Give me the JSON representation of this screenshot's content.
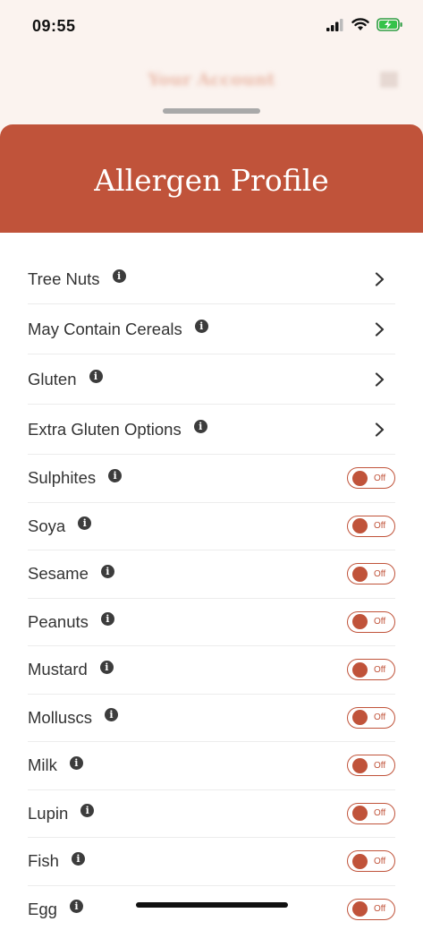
{
  "status": {
    "time": "09:55"
  },
  "background": {
    "title": "Your Account"
  },
  "sheet": {
    "title": "Allergen Profile"
  },
  "nav_items": [
    {
      "label": "Tree Nuts"
    },
    {
      "label": "May Contain Cereals"
    },
    {
      "label": "Gluten"
    },
    {
      "label": "Extra Gluten Options"
    }
  ],
  "toggle_items": [
    {
      "label": "Sulphites",
      "state": "Off"
    },
    {
      "label": "Soya",
      "state": "Off"
    },
    {
      "label": "Sesame",
      "state": "Off"
    },
    {
      "label": "Peanuts",
      "state": "Off"
    },
    {
      "label": "Mustard",
      "state": "Off"
    },
    {
      "label": "Molluscs",
      "state": "Off"
    },
    {
      "label": "Milk",
      "state": "Off"
    },
    {
      "label": "Lupin",
      "state": "Off"
    },
    {
      "label": "Fish",
      "state": "Off"
    },
    {
      "label": "Egg",
      "state": "Off"
    }
  ],
  "colors": {
    "accent": "#c0533a",
    "background": "#fbf3ef"
  },
  "icons": {
    "info": "info-icon",
    "chevron": "chevron-right-icon"
  }
}
